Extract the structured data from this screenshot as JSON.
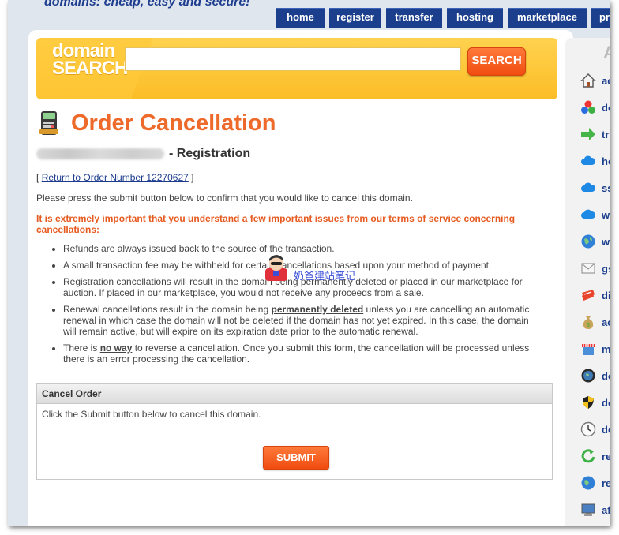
{
  "header": {
    "tagline": "domains: cheap, easy and secure!",
    "nav_tabs": [
      {
        "label": "home"
      },
      {
        "label": "register"
      },
      {
        "label": "transfer"
      },
      {
        "label": "hosting"
      },
      {
        "label": "marketplace"
      },
      {
        "label": "pricing"
      }
    ]
  },
  "search": {
    "logo_line1": "domain",
    "logo_line2": "SEARCH",
    "placeholder": "",
    "button_label": "SEARCH"
  },
  "page": {
    "title": "Order Cancellation",
    "domain_suffix": "- Registration",
    "return_prefix": "[",
    "return_link": "Return to Order Number 12270627",
    "return_suffix": "]",
    "intro": "Please press the submit button below to confirm that you would like to cancel this domain.",
    "warning": "It is extremely important that you understand a few important issues from our terms of service concerning cancellations:",
    "bullets": {
      "b1": "Refunds are always issued back to the source of the transaction.",
      "b2": "A small transaction fee may be withheld for certain cancellations based upon your method of payment.",
      "b3": "Registration cancellations will result in the domain being permanently deleted or placed in our marketplace for auction. If placed in our marketplace, you would not receive any proceeds from a sale.",
      "b4_pre": "Renewal cancellations result in the domain being ",
      "b4_bold": "permanently deleted",
      "b4_post": " unless you are cancelling an automatic renewal in which case the domain will not be deleted if the domain has not yet expired. In this case, the domain will remain active, but will expire on its expiration date prior to the automatic renewal.",
      "b5_pre": "There is ",
      "b5_bold": "no way",
      "b5_post": " to reverse a cancellation. Once you submit this form, the cancellation will be processed unless there is an error processing the cancellation."
    }
  },
  "cancel_panel": {
    "header": "Cancel Order",
    "body": "Click the Submit button below to cancel this domain.",
    "submit_label": "SUBMIT"
  },
  "sidebar": {
    "heading": "A",
    "items": [
      {
        "label": "ac",
        "icon": "house-icon"
      },
      {
        "label": "do",
        "icon": "colored-balls-icon"
      },
      {
        "label": "tr",
        "icon": "green-arrow-icon"
      },
      {
        "label": "ho",
        "icon": "cloud-icon"
      },
      {
        "label": "ss",
        "icon": "cloud-icon"
      },
      {
        "label": "w",
        "icon": "cloud-icon"
      },
      {
        "label": "w",
        "icon": "globe-icon"
      },
      {
        "label": "gs",
        "icon": "envelope-icon"
      },
      {
        "label": "di",
        "icon": "ticket-icon"
      },
      {
        "label": "ac",
        "icon": "money-bag-icon"
      },
      {
        "label": "m",
        "icon": "storefront-icon"
      },
      {
        "label": "do",
        "icon": "globe-dark-icon"
      },
      {
        "label": "do",
        "icon": "shield-icon"
      },
      {
        "label": "do",
        "icon": "clock-icon"
      },
      {
        "label": "re",
        "icon": "green-renew-icon"
      },
      {
        "label": "re",
        "icon": "globe-icon"
      },
      {
        "label": "af",
        "icon": "monitor-icon"
      }
    ]
  },
  "watermark": {
    "text": "奶爸建站笔记"
  }
}
